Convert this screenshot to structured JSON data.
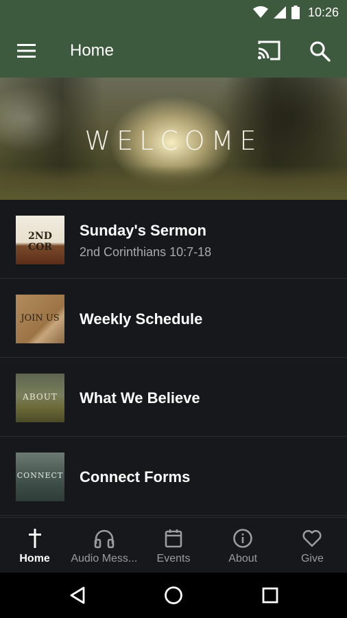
{
  "status": {
    "time": "10:26",
    "icons": [
      "wifi-icon",
      "cell-signal-icon",
      "battery-icon"
    ]
  },
  "appbar": {
    "title": "Home",
    "icons": [
      "menu-icon",
      "cast-icon",
      "search-icon"
    ]
  },
  "hero": {
    "text": "WELCOME"
  },
  "list": [
    {
      "thumb_text": "2ND COR",
      "title": "Sunday's Sermon",
      "subtitle": "2nd Corinthians 10:7-18"
    },
    {
      "thumb_text": "JOIN US",
      "title": "Weekly Schedule",
      "subtitle": ""
    },
    {
      "thumb_text": "ABOUT",
      "title": "What We Believe",
      "subtitle": ""
    },
    {
      "thumb_text": "CONNECT",
      "title": "Connect Forms",
      "subtitle": ""
    }
  ],
  "bottom_nav": [
    {
      "label": "Home",
      "icon": "cross-icon",
      "active": true
    },
    {
      "label": "Audio Mess...",
      "icon": "headphones-icon",
      "active": false
    },
    {
      "label": "Events",
      "icon": "calendar-icon",
      "active": false
    },
    {
      "label": "About",
      "icon": "info-icon",
      "active": false
    },
    {
      "label": "Give",
      "icon": "heart-icon",
      "active": false
    }
  ],
  "system_nav": [
    "back-icon",
    "home-circle-icon",
    "recents-icon"
  ],
  "colors": {
    "appbar": "#3d5a3f",
    "background": "#16181b",
    "divider": "#2a2c2f",
    "subtitle": "#a8aaad",
    "inactive_tab": "#9a9c9f"
  }
}
